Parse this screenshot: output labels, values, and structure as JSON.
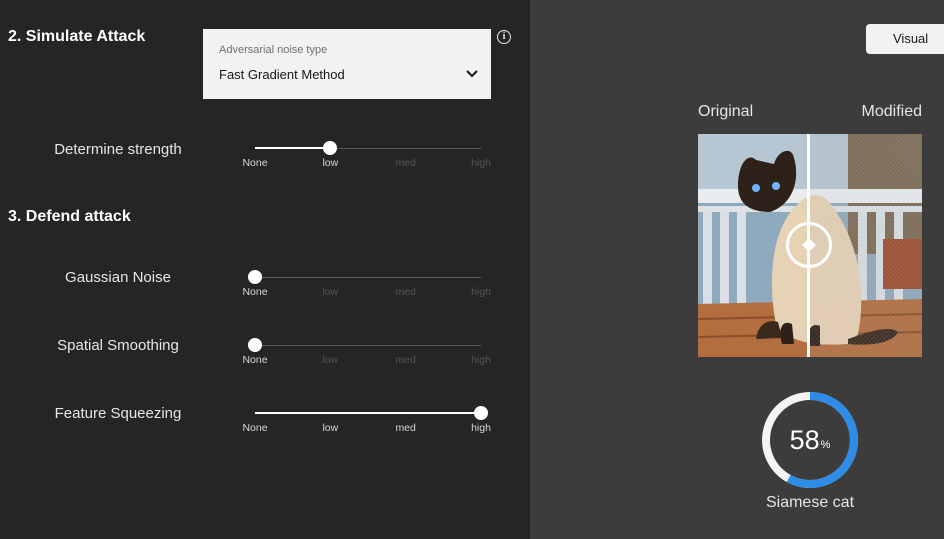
{
  "attack": {
    "section_title": "2. Simulate Attack",
    "dropdown": {
      "label": "Adversarial noise type",
      "value": "Fast Gradient Method"
    },
    "info_icon": "info-icon",
    "strength": {
      "label": "Determine strength",
      "level": 1,
      "ticks": [
        "None",
        "low",
        "med",
        "high"
      ]
    }
  },
  "defense": {
    "section_title": "3. Defend attack",
    "rows": [
      {
        "label": "Gaussian Noise",
        "level": 0,
        "ticks": [
          "None",
          "low",
          "med",
          "high"
        ]
      },
      {
        "label": "Spatial Smoothing",
        "level": 0,
        "ticks": [
          "None",
          "low",
          "med",
          "high"
        ]
      },
      {
        "label": "Feature Squeezing",
        "level": 3,
        "ticks": [
          "None",
          "low",
          "med",
          "high"
        ]
      }
    ]
  },
  "result": {
    "visual_button": "Visual",
    "original_label": "Original",
    "modified_label": "Modified",
    "confidence": "58",
    "confidence_unit": "%",
    "prediction": "Siamese cat",
    "colors": {
      "gauge_fill": "#2d8ce6",
      "gauge_track": "#f4f4f4"
    }
  }
}
